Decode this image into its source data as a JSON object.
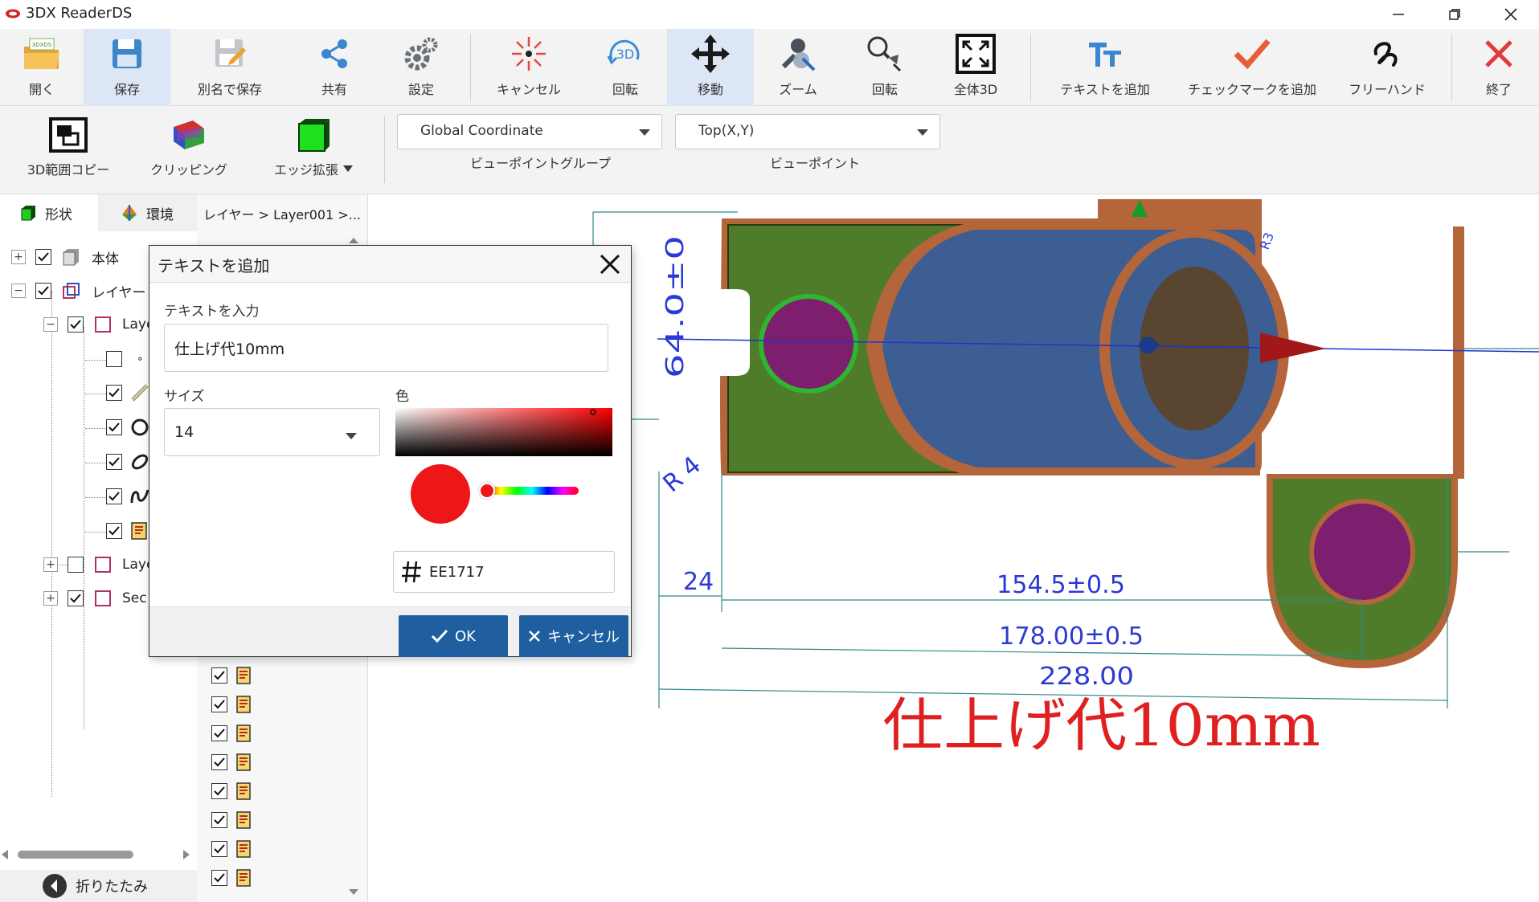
{
  "window": {
    "title": "3DX ReaderDS"
  },
  "toolbar": {
    "open": "開く",
    "save": "保存",
    "save_as": "別名で保存",
    "share": "共有",
    "settings": "設定",
    "cancel": "キャンセル",
    "rotate3d": "回転",
    "move": "移動",
    "zoom": "ズーム",
    "rotate": "回転",
    "fit3d": "全体3D",
    "add_text": "テキストを追加",
    "add_check": "チェックマークを追加",
    "freehand": "フリーハンド",
    "exit": "終了",
    "open_badge": "3DXDS",
    "rotate_badge": "3D"
  },
  "toolbar2": {
    "copy3d": "3D範囲コピー",
    "clipping": "クリッピング",
    "edge_expand": "エッジ拡張",
    "viewpoint_group_value": "Global Coordinate",
    "viewpoint_group_label": "ビューポイントグループ",
    "viewpoint_value": "Top(X,Y)",
    "viewpoint_label": "ビューポイント"
  },
  "left_panel": {
    "tab_shape": "形状",
    "tab_env": "環境",
    "tree": {
      "body": "本体",
      "layer": "レイヤー",
      "layer_child1": "Laye",
      "layer_child2": "Laye",
      "sec": "Sec",
      "dot": "∘"
    },
    "collapse": "折りたたみ"
  },
  "panel2": {
    "breadcrumb": "レイヤー > Layer001 >..."
  },
  "dialog": {
    "title": "テキストを追加",
    "text_label": "テキストを入力",
    "text_value": "仕上げ代10mm",
    "size_label": "サイズ",
    "size_value": "14",
    "color_label": "色",
    "hex_value": "EE1717",
    "ok": "OK",
    "cancel": "キャンセル"
  },
  "drawing": {
    "dim_top": "64.0±0",
    "dim_24": "24",
    "dim_154": "154.5±0.5",
    "dim_178": "178.00±0.5",
    "dim_228": "228.00",
    "dim_r4": "R 4",
    "annotation": "仕上げ代10mm",
    "small_dim": "R3"
  },
  "colors": {
    "accent": "#1f5fa0",
    "selected_color": "#ee1717",
    "part_green": "#4e7c2a",
    "part_copper": "#b4653a",
    "part_blue": "#3d5e93",
    "hole_purple": "#7e1e6e",
    "dim_blue": "#2b39d6",
    "annotation_red": "#e02020"
  }
}
